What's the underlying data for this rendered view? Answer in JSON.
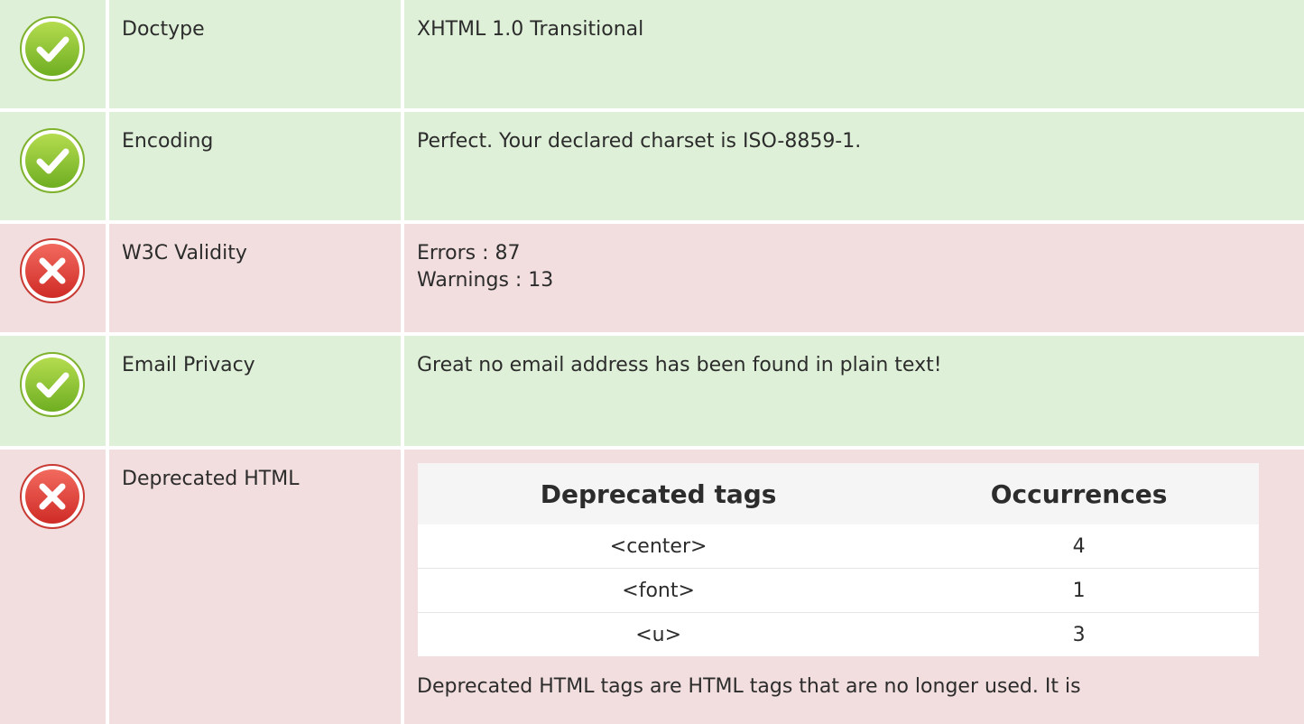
{
  "rows": [
    {
      "status": "pass",
      "icon": "check-circle-icon",
      "label": "Doctype",
      "value": "XHTML 1.0 Transitional"
    },
    {
      "status": "pass",
      "icon": "check-circle-icon",
      "label": "Encoding",
      "value": "Perfect. Your declared charset is ISO-8859-1."
    },
    {
      "status": "fail",
      "icon": "x-circle-icon",
      "label": "W3C Validity",
      "errors": "Errors : 87",
      "warnings": "Warnings : 13"
    },
    {
      "status": "pass",
      "icon": "check-circle-icon",
      "label": "Email Privacy",
      "value": "Great no email address has been found in plain text!"
    },
    {
      "status": "fail",
      "icon": "x-circle-icon",
      "label": "Deprecated HTML",
      "table": {
        "headers": [
          "Deprecated tags",
          "Occurrences"
        ],
        "rows": [
          [
            "<center>",
            "4"
          ],
          [
            "<font>",
            "1"
          ],
          [
            "<u>",
            "3"
          ]
        ]
      },
      "note": "Deprecated HTML tags are HTML tags that are no longer used. It is"
    }
  ],
  "colors": {
    "pass_bg": "#dff0d8",
    "fail_bg": "#f2dede",
    "check_green": "#8cc63f",
    "cross_red": "#e2403a"
  }
}
